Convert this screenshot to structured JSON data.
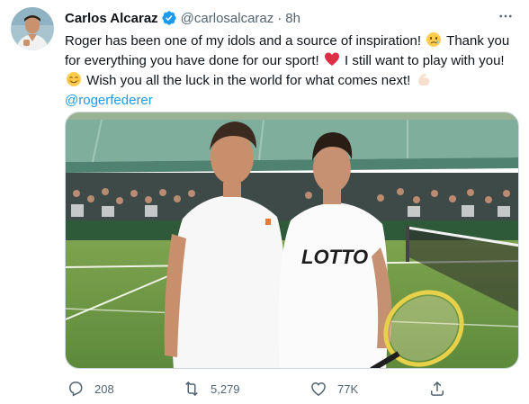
{
  "tweet": {
    "author_name": "Carlos Alcaraz",
    "author_handle": "@carlosalcaraz",
    "separator": "·",
    "timestamp": "8h",
    "text_lines": [
      "Roger has been one of my idols and a source of inspiration!",
      "Thank you",
      "for everything you have done for our sport!",
      "I still want to play with you!",
      "Wish you all the luck in the world for what comes next!",
      "@rogerfederer"
    ],
    "emoji": [
      "crying-face-emoji",
      "red-heart-emoji",
      "smiling-face-emoji",
      "flexed-biceps-emoji"
    ],
    "mention": "@rogerfederer"
  },
  "photo": {
    "shirt_brand": "LOTTO"
  },
  "actions": {
    "reply_count": "208",
    "retweet_count": "5,279",
    "like_count": "77K"
  },
  "icons": {
    "verified": "verified-badge-icon",
    "more": "more-options-icon",
    "reply": "reply-icon",
    "retweet": "retweet-icon",
    "like": "like-icon",
    "share": "share-icon"
  },
  "colors": {
    "accent": "#1d9bf0",
    "text_primary": "#0f1419",
    "text_secondary": "#536471",
    "heart": "#e0245e"
  }
}
